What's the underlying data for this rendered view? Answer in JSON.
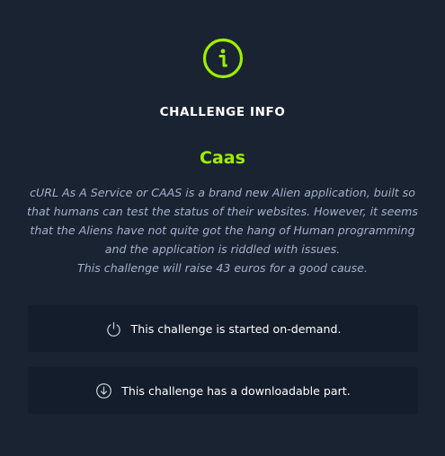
{
  "modal": {
    "icon": "info-circle-icon",
    "heading": "CHALLENGE INFO",
    "title": "Caas",
    "description": "cURL As A Service or CAAS is a brand new Alien application, built so that humans can test the status of their websites. However, it seems that the Aliens have not quite got the hang of Human programming and the application is riddled with issues.",
    "charity_note": "This challenge will raise 43 euros for a good cause.",
    "cards": [
      {
        "icon": "power-icon",
        "label": "This challenge is started on-demand."
      },
      {
        "icon": "download-icon",
        "label": "This challenge has a downloadable part."
      }
    ]
  },
  "colors": {
    "background": "#1a2332",
    "card_background": "#141d2b",
    "accent": "#9fef00",
    "description_text": "#a4b1cd"
  }
}
